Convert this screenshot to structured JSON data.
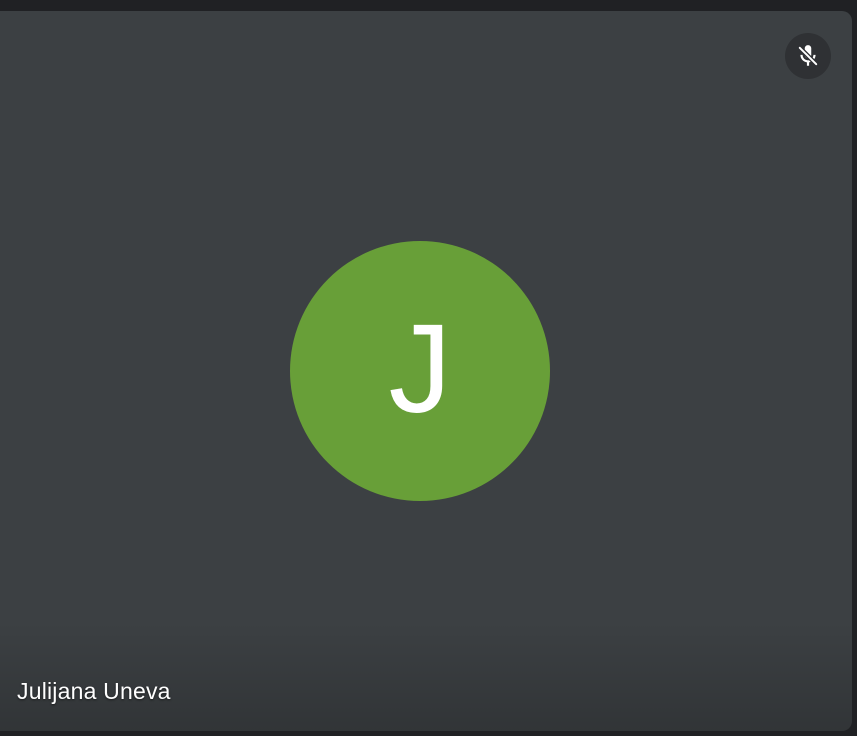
{
  "participant": {
    "name": "Julijana Uneva",
    "initial": "J",
    "avatar_color": "#689f38",
    "muted": true
  },
  "tile": {
    "background_color": "#3c4043"
  },
  "icons": {
    "mute_indicator": "mic-off-icon"
  }
}
